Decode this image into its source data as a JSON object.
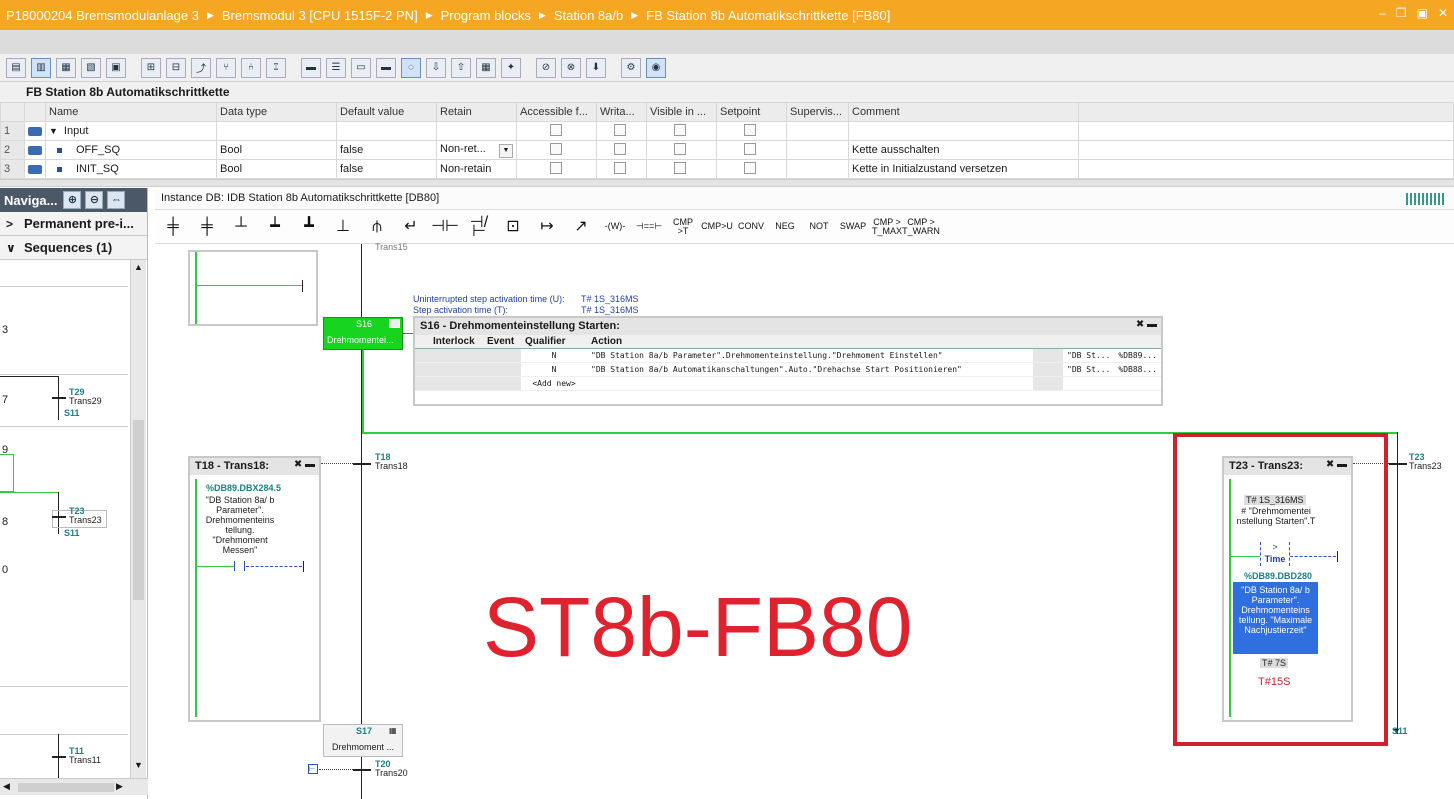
{
  "titlebar": {
    "crumbs": [
      "P18000204 Bremsmodulanlage 3",
      "Bremsmodul 3 [CPU 1515F-2 PN]",
      "Program blocks",
      "Station 8a/b",
      "FB Station 8b Automatikschrittkette [FB80]"
    ],
    "controls": [
      "‒",
      "❐",
      "▣",
      "✕"
    ]
  },
  "interface": {
    "title": "FB Station 8b Automatikschrittkette",
    "columns": [
      "Name",
      "Data type",
      "Default value",
      "Retain",
      "Accessible f...",
      "Writa...",
      "Visible in ...",
      "Setpoint",
      "Supervis...",
      "Comment"
    ],
    "rows": [
      {
        "num": "1",
        "name": "Input",
        "type": "",
        "default": "",
        "retain": "",
        "comment": ""
      },
      {
        "num": "2",
        "name": "OFF_SQ",
        "type": "Bool",
        "default": "false",
        "retain": "Non-ret...",
        "comment": "Kette ausschalten"
      },
      {
        "num": "3",
        "name": "INIT_SQ",
        "type": "Bool",
        "default": "false",
        "retain": "Non-retain",
        "comment": "Kette in Initialzustand versetzen"
      }
    ]
  },
  "nav": {
    "title": "Naviga...",
    "sections": [
      {
        "arrow": ">",
        "label": "Permanent pre-i..."
      },
      {
        "arrow": "∨",
        "label": "Sequences (1)"
      }
    ],
    "numbers": [
      "3",
      "7",
      "9",
      "8",
      "0"
    ],
    "transitions": [
      {
        "id": "T29",
        "name": "Trans29",
        "step": "S11"
      },
      {
        "id": "T23",
        "name": "Trans23",
        "step": "S11"
      },
      {
        "id": "T11",
        "name": "Trans11",
        "step": ""
      }
    ]
  },
  "editor": {
    "instance_db": "Instance DB: IDB Station 8b Automatikschrittkette [DB80]",
    "toolbar2": [
      "CMP >T",
      "CMP>U",
      "CONV",
      "NEG",
      "NOT",
      "SWAP",
      "CMP > T_MAX",
      "CMP > T_WARN"
    ],
    "u_label": "Uninterrupted step activation time (U):",
    "u_value": "T# 1S_316MS",
    "t_label": "Step activation time (T):",
    "t_value": "T# 1S_316MS",
    "s16": {
      "num": "S16",
      "short": "Drehmomentei...",
      "title": "S16 - Drehmomenteinstellung Starten:",
      "columns": [
        "Interlock",
        "Event",
        "Qualifier",
        "Action"
      ],
      "rows": [
        {
          "qualifier": "N",
          "action": "\"DB Station 8a/b Parameter\".Drehmomenteinstellung.\"Drehmoment Einstellen\"",
          "ref1": "\"DB St...",
          "ref2": "%DB89..."
        },
        {
          "qualifier": "N",
          "action": "\"DB Station 8a/b Automatikanschaltungen\".Auto.\"Drehachse Start Positionieren\"",
          "ref1": "\"DB St...",
          "ref2": "%DB88..."
        },
        {
          "qualifier": "<Add new>",
          "action": "",
          "ref1": "",
          "ref2": ""
        }
      ]
    },
    "t18": {
      "title": "T18 - Trans18:",
      "id": "T18",
      "name": "Trans18",
      "addr": "%DB89.DBX284.5",
      "operand": "\"DB Station 8a/ b Parameter\". Drehmomenteins tellung. \"Drehmoment Messen\""
    },
    "t23": {
      "title": "T23 - Trans23:",
      "id": "T23",
      "name": "Trans23",
      "time_value": "T# 1S_316MS",
      "timer_operand": "# \"Drehmomentei nstellung Starten\".T",
      "cmp": ">",
      "cmp_type": "Time",
      "addr": "%DB89.DBD280",
      "operand2": "\"DB Station 8a/ b Parameter\". Drehmomenteins tellung. \"Maximale Nachjustierzeit\"",
      "result": "T# 7S",
      "red_note": "T#15S",
      "step": "S11"
    },
    "s17": {
      "num": "S17",
      "short": "Drehmoment ..."
    },
    "t20": {
      "id": "T20",
      "name": "Trans20"
    },
    "top_stub": "Trans15",
    "overlay_label": "ST8b-FB80"
  }
}
